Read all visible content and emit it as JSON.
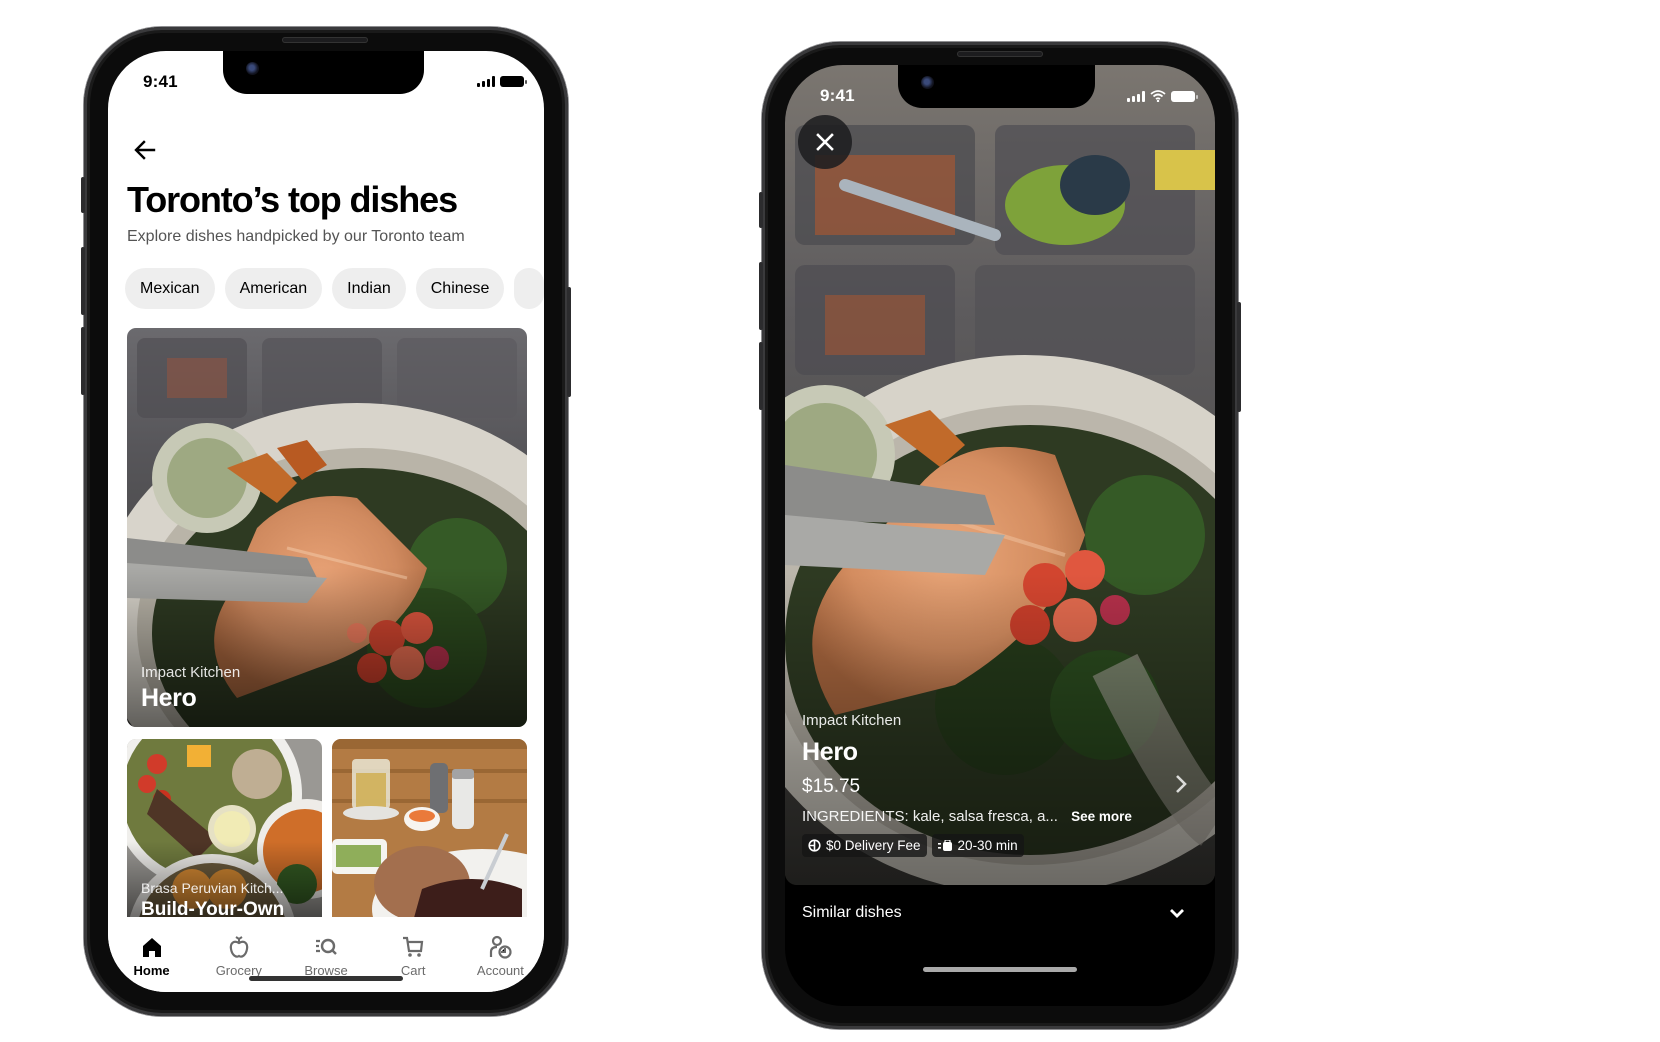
{
  "phone_left": {
    "status_bar": {
      "time": "9:41",
      "icons": [
        "cellular-signal-icon",
        "battery-icon"
      ]
    },
    "back_button": {
      "icon": "arrow-left-icon"
    },
    "header": {
      "title": "Toronto’s top dishes",
      "subtitle": "Explore dishes handpicked by our Toronto team"
    },
    "cuisine_chips": [
      {
        "label": "Mexican"
      },
      {
        "label": "American"
      },
      {
        "label": "Indian"
      },
      {
        "label": "Chinese"
      },
      {
        "label": ""
      }
    ],
    "featured_card": {
      "restaurant": "Impact Kitchen",
      "dish": "Hero"
    },
    "grid_cards": [
      {
        "restaurant": "Brasa Peruvian Kitch...",
        "dish": "Build-Your-Own"
      },
      {
        "restaurant": "",
        "dish": ""
      }
    ],
    "tab_bar": {
      "active": "Home",
      "tabs": [
        {
          "label": "Home",
          "icon": "home-icon"
        },
        {
          "label": "Grocery",
          "icon": "apple-icon"
        },
        {
          "label": "Browse",
          "icon": "browse-search-icon"
        },
        {
          "label": "Cart",
          "icon": "cart-icon"
        },
        {
          "label": "Account",
          "icon": "account-icon"
        }
      ]
    }
  },
  "phone_right": {
    "status_bar": {
      "time": "9:41",
      "icons": [
        "cellular-signal-icon",
        "wifi-icon",
        "battery-icon"
      ]
    },
    "close_button": {
      "icon": "close-icon"
    },
    "dish_detail": {
      "restaurant": "Impact Kitchen",
      "dish": "Hero",
      "price": "$15.75",
      "ingredients": "INGREDIENTS: kale, salsa fresca, a...",
      "see_more": "See more",
      "badges": [
        {
          "icon": "uber-one-icon",
          "label": "$0 Delivery Fee"
        },
        {
          "icon": "delivery-time-icon",
          "label": "20-30 min"
        }
      ],
      "next_icon": "chevron-right-icon"
    },
    "similar_dishes": {
      "label": "Similar dishes",
      "icon": "chevron-down-icon"
    }
  },
  "colors": {
    "chip_bg": "#eeeeee",
    "text_primary": "#000000",
    "text_secondary": "#545454",
    "tab_inactive": "#6b6b6b",
    "dark_bg": "#000000"
  }
}
